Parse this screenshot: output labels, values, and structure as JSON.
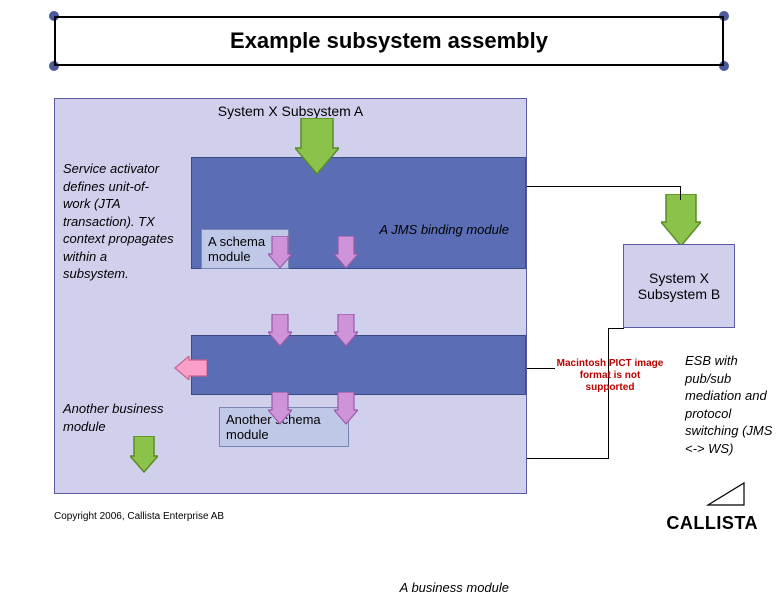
{
  "title": "Example subsystem assembly",
  "subsystemA": {
    "title": "System X Subsystem A",
    "jmsBinding": "A JMS binding module",
    "schema1": "A schema module",
    "business": "A business module",
    "schema2": "Another schema module"
  },
  "subsystemB": "System X Subsystem B",
  "notes": {
    "serviceActivator": "Service activator defines unit-of-work (JTA transaction). TX context propagates within a subsystem.",
    "anotherBusiness": "Another business module",
    "esb": "ESB with pub/sub mediation and protocol switching (JMS <-> WS)"
  },
  "placeholder": "Macintosh PICT image format is not supported",
  "brand": "CALLISTA",
  "copyright": "Copyright 2006, Callista Enterprise AB"
}
